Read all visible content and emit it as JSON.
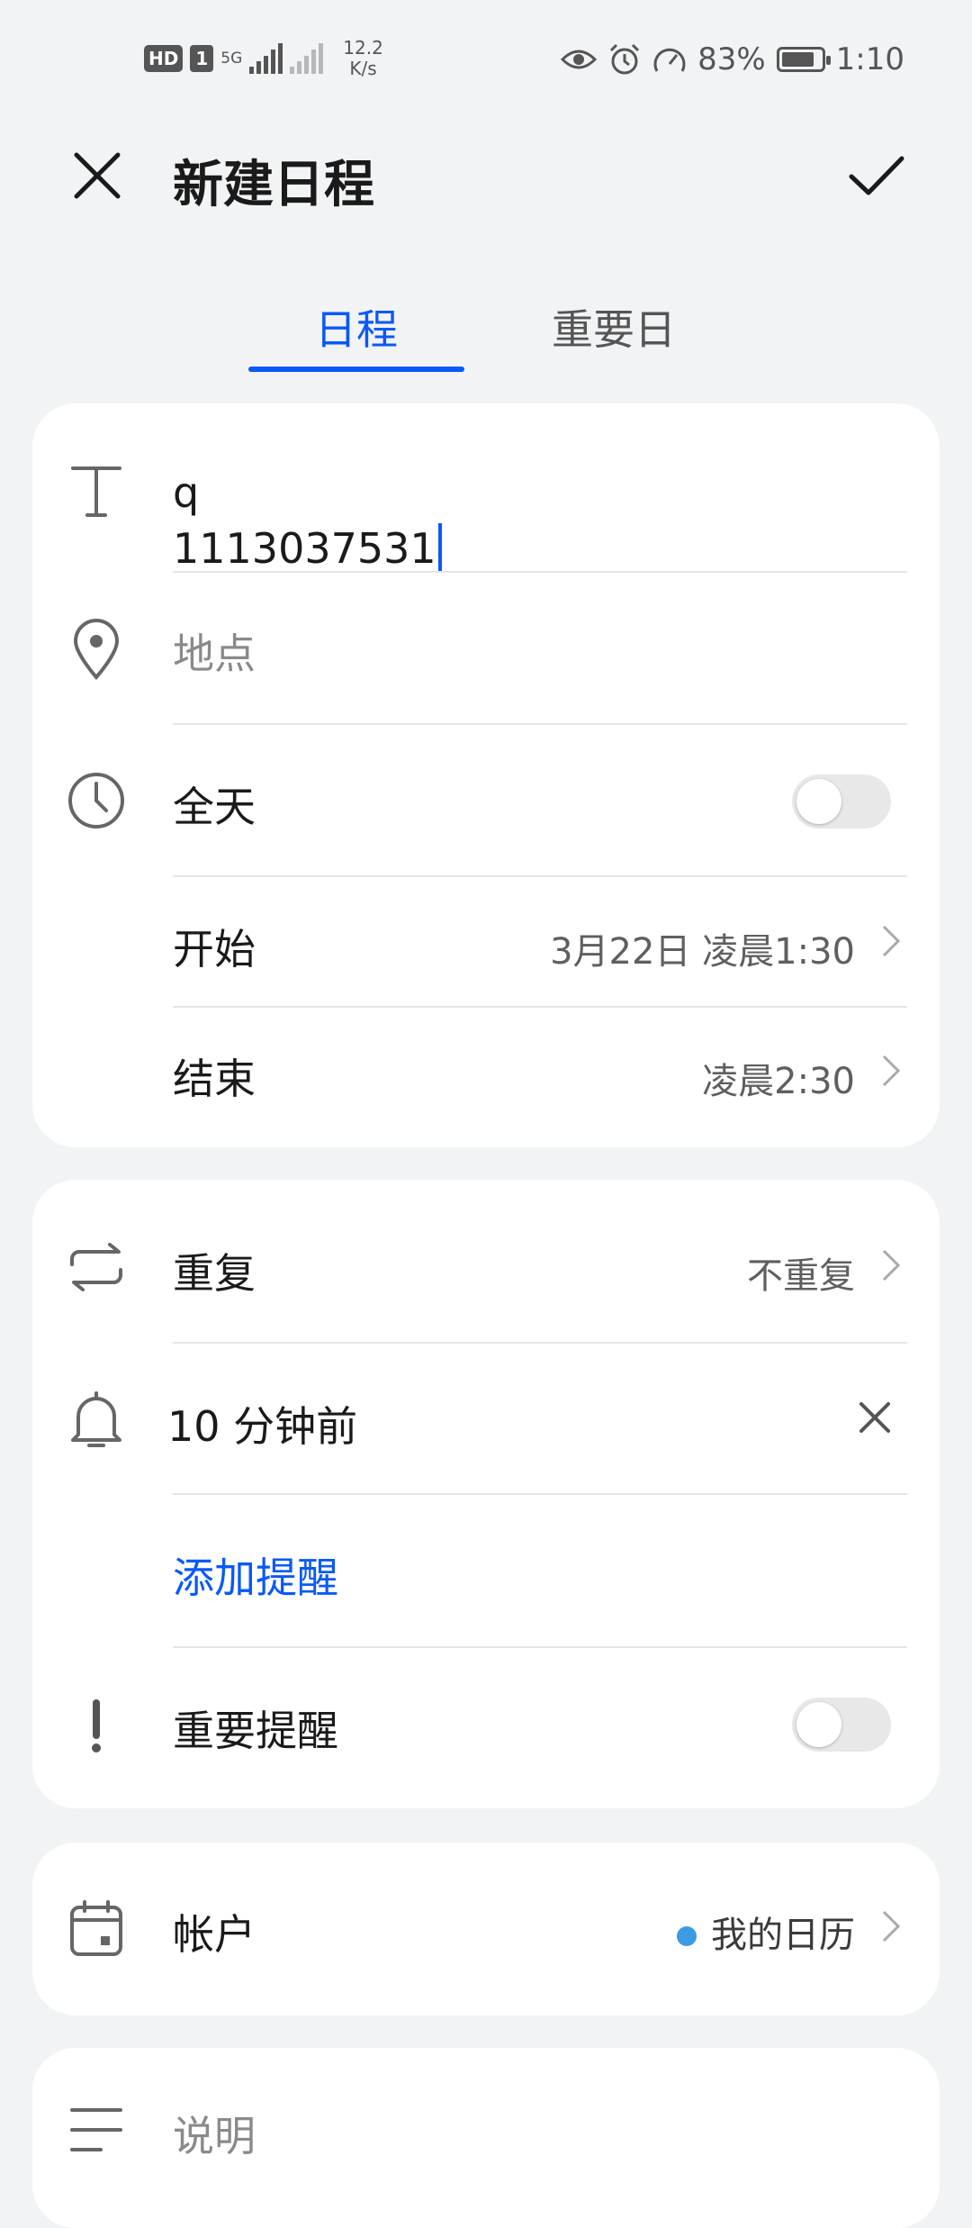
{
  "status_bar": {
    "hd": "HD",
    "sim": "1",
    "network": "5G",
    "speed_value": "12.2",
    "speed_unit": "K/s",
    "battery": "83%",
    "battery_level": 0.83,
    "time": "1:10",
    "icons": [
      "eye-icon",
      "alarm-icon",
      "speedometer-icon"
    ]
  },
  "header": {
    "title": "新建日程",
    "close_icon": "close-icon",
    "confirm_icon": "check-icon"
  },
  "tabs": [
    {
      "label": "日程",
      "active": true
    },
    {
      "label": "重要日",
      "active": false
    }
  ],
  "event": {
    "title_line1": "q",
    "title_line2": "1113037531",
    "location_placeholder": "地点",
    "all_day_label": "全天",
    "all_day_on": false,
    "start_label": "开始",
    "start_value": "3月22日 凌晨1:30",
    "end_label": "结束",
    "end_value": "凌晨2:30"
  },
  "reminders": {
    "repeat_label": "重复",
    "repeat_value": "不重复",
    "reminder_value": "10 分钟前",
    "add_reminder": "添加提醒",
    "important_label": "重要提醒",
    "important_on": false
  },
  "account": {
    "label": "帐户",
    "value": "我的日历",
    "dot_color": "#3b9be3"
  },
  "description": {
    "label": "说明"
  },
  "colors": {
    "accent": "#0a59f7",
    "background": "#f1f3f5"
  }
}
